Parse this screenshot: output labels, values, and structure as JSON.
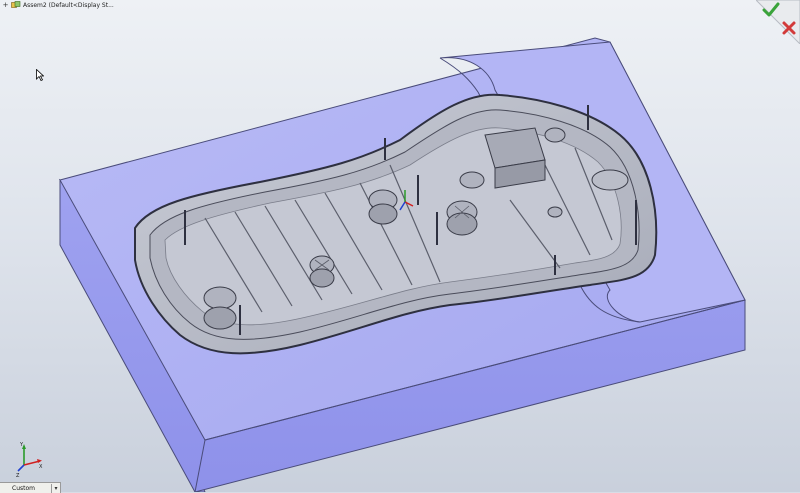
{
  "tree": {
    "expander": "+",
    "item_label": "Assem2 (Default<Display St..."
  },
  "confirm": {
    "ok_icon": "green-checkmark-icon",
    "cancel_icon": "red-x-icon",
    "ok_color": "#3aa33a",
    "cancel_color": "#d23a3a"
  },
  "triad": {
    "x": "X",
    "y": "Y",
    "z": "Z"
  },
  "view_bar": {
    "orientation": "Custom"
  },
  "colors": {
    "mold_top": "#aeb0f3",
    "mold_side": "#8f92ec",
    "cavity": "#b8bbc8",
    "cavity_dark": "#8d919e",
    "edge": "#3a3a4a"
  }
}
